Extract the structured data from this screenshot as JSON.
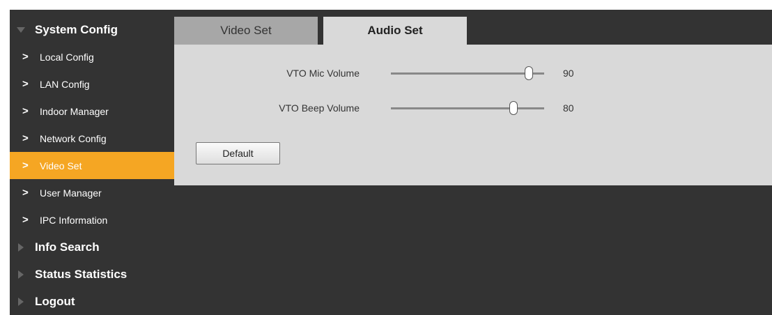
{
  "sidebar": {
    "groups": [
      {
        "label": "System Config",
        "expanded": true,
        "items": [
          {
            "label": "Local Config",
            "active": false
          },
          {
            "label": "LAN Config",
            "active": false
          },
          {
            "label": "Indoor Manager",
            "active": false
          },
          {
            "label": "Network Config",
            "active": false
          },
          {
            "label": "Video Set",
            "active": true
          },
          {
            "label": "User Manager",
            "active": false
          },
          {
            "label": "IPC Information",
            "active": false
          }
        ]
      },
      {
        "label": "Info Search",
        "expanded": false
      },
      {
        "label": "Status Statistics",
        "expanded": false
      },
      {
        "label": "Logout",
        "expanded": false
      }
    ]
  },
  "tabs": [
    {
      "label": "Video Set",
      "active": false
    },
    {
      "label": "Audio Set",
      "active": true
    }
  ],
  "audio": {
    "mic_label": "VTO Mic Volume",
    "mic_value": "90",
    "mic_level": 90,
    "beep_label": "VTO Beep Volume",
    "beep_value": "80",
    "beep_level": 80,
    "default_label": "Default"
  },
  "colors": {
    "background": "#333333",
    "active_item": "#f5a623",
    "panel": "#d9d9d9",
    "inactive_tab": "#a7a7a7"
  }
}
